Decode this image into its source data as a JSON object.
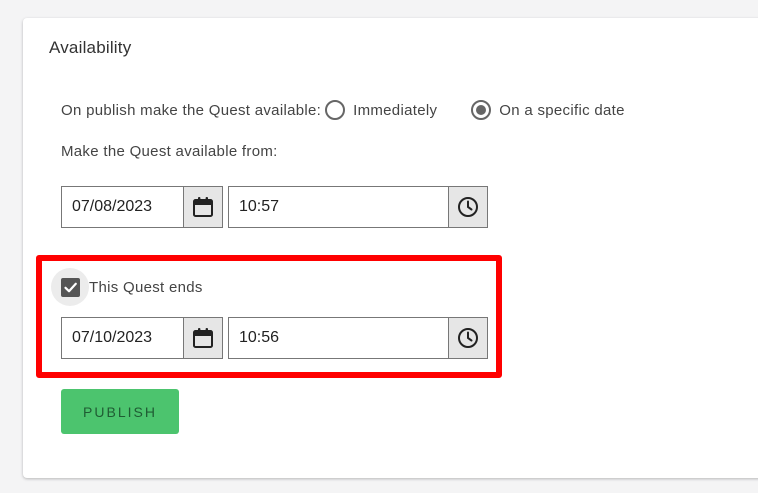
{
  "availability": {
    "title": "Availability",
    "publish_prompt": "On publish make the Quest available:",
    "options": [
      {
        "label": "Immediately",
        "selected": false
      },
      {
        "label": "On a specific date",
        "selected": true
      }
    ],
    "from_label": "Make the Quest available from:",
    "start_date": "07/08/2023",
    "start_time": "10:57",
    "ends_label": "This Quest ends",
    "ends_checked": true,
    "end_date": "07/10/2023",
    "end_time": "10:56",
    "publish_label": "PUBLISH"
  },
  "icons": {
    "date": "calendar-icon",
    "time": "clock-icon",
    "check": "checkmark-icon"
  },
  "colors": {
    "publish_button": "#4cc46e",
    "highlight_box": "#ff0000",
    "checkbox": "#555555"
  }
}
